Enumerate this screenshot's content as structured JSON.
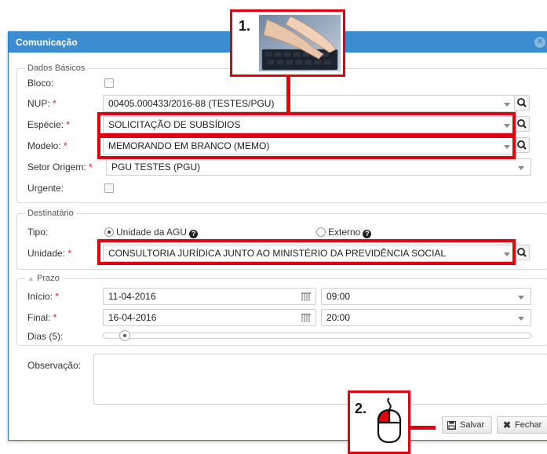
{
  "dialog": {
    "title": "Comunicação",
    "close_icon": "close-icon"
  },
  "dados_basicos": {
    "legend": "Dados Básicos",
    "bloco_label": "Bloco:",
    "nup_label": "NUP:",
    "nup_value": "00405.000433/2016-88 (TESTES/PGU)",
    "especie_label": "Espécie:",
    "especie_value": "SOLICITAÇÃO DE SUBSÍDIOS",
    "modelo_label": "Modelo:",
    "modelo_value": "MEMORANDO EM BRANCO (MEMO)",
    "setor_label": "Setor Origem:",
    "setor_value": "PGU TESTES (PGU)",
    "urgente_label": "Urgente:",
    "required_mark": "*"
  },
  "destinatario": {
    "legend": "Destinatário",
    "tipo_label": "Tipo:",
    "option_agu": "Unidade da AGU",
    "option_externo": "Externo",
    "selected": "Unidade da AGU",
    "unidade_label": "Unidade:",
    "unidade_value": "CONSULTORIA JURÍDICA JUNTO AO MINISTÉRIO DA PREVIDÊNCIA SOCIAL",
    "help_glyph": "?"
  },
  "prazo": {
    "legend": "Prazo",
    "inicio_label": "Início:",
    "inicio_date": "11-04-2016",
    "inicio_time": "09:00",
    "final_label": "Final:",
    "final_date": "16-04-2016",
    "final_time": "20:00",
    "dias_label": "Dias (5):",
    "dias_slider_fraction": 0.02
  },
  "observacao_label": "Observação:",
  "buttons": {
    "salvar": "Salvar",
    "fechar": "Fechar"
  },
  "callouts": {
    "step1": "1.",
    "step2": "2."
  },
  "colors": {
    "titlebar": "#3c8dcf",
    "highlight": "#e3000f",
    "required": "#e02020"
  }
}
